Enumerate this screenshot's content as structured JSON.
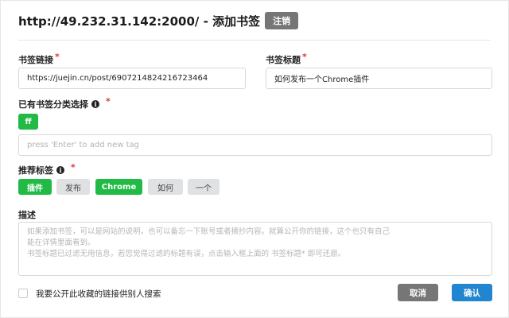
{
  "header": {
    "title": "http://49.232.31.142:2000/ - 添加书签",
    "logout_label": "注销"
  },
  "form": {
    "url_label": "书签链接",
    "url_value": "https://juejin.cn/post/6907214824216723464",
    "title_label": "书签标题",
    "title_value": "如何发布一个Chrome插件",
    "category_label": "已有书签分类选择",
    "selected_categories": [
      "ff"
    ],
    "tag_input_placeholder": "press 'Enter' to add new tag",
    "recommend_label": "推荐标签",
    "recommended_tags": [
      {
        "label": "插件",
        "selected": true
      },
      {
        "label": "发布",
        "selected": false
      },
      {
        "label": "Chrome",
        "selected": true
      },
      {
        "label": "如何",
        "selected": false
      },
      {
        "label": "一个",
        "selected": false
      }
    ],
    "desc_label": "描述",
    "desc_placeholder_lines": [
      "如果添加书签，可以是网站的说明，也可以备忘一下账号或者摘抄内容。就算公开你的链接，这个也只有自己",
      "能在详情里面看到。",
      "书签标题已过滤无用信息，若您觉得过滤的标题有误，点击输入框上面的 书签标题* 即可还原。"
    ],
    "public_checkbox_label": "我要公开此收藏的链接供别人搜索",
    "public_checked": false,
    "required_mark": "*",
    "info_icon_glyph": "i"
  },
  "actions": {
    "cancel_label": "取消",
    "confirm_label": "确认"
  },
  "colors": {
    "green": "#21ba45",
    "blue": "#2185d0",
    "grey_button": "#767676",
    "tag_grey": "#e0e1e2",
    "required": "#dd3333"
  }
}
